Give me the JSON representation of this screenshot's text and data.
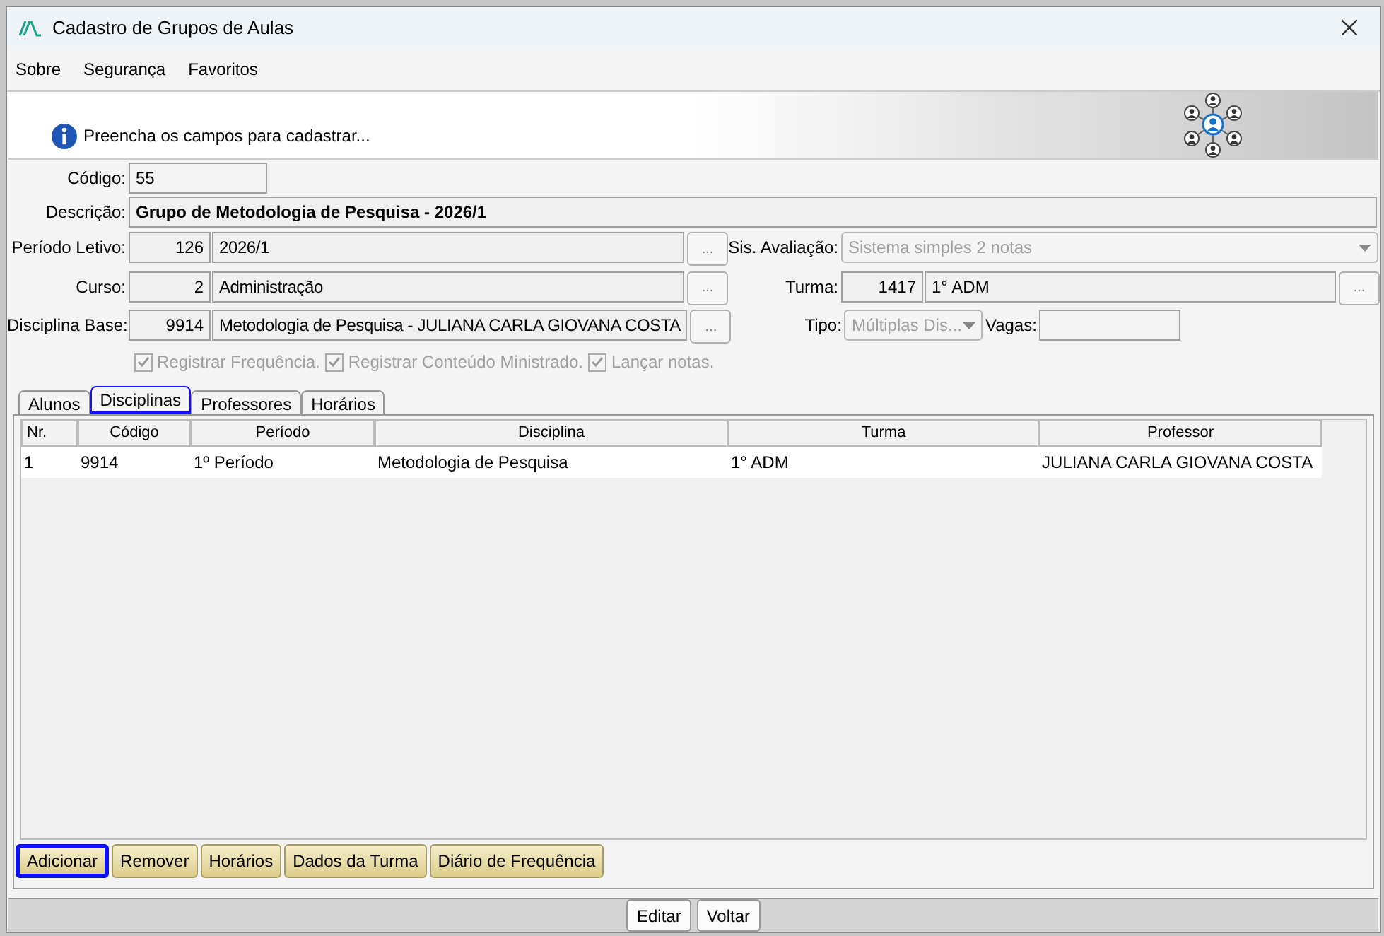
{
  "window": {
    "title": "Cadastro de Grupos de Aulas"
  },
  "menu": [
    {
      "label": "Sobre"
    },
    {
      "label": "Segurança"
    },
    {
      "label": "Favoritos"
    }
  ],
  "info": {
    "message": "Preencha os campos para cadastrar..."
  },
  "form": {
    "codigo": {
      "label": "Código:",
      "value": "55"
    },
    "descricao": {
      "label": "Descrição:",
      "value": "Grupo de Metodologia de Pesquisa - 2026/1"
    },
    "periodo": {
      "label": "Período Letivo:",
      "code": "126",
      "value": "2026/1",
      "button": "..."
    },
    "curso": {
      "label": "Curso:",
      "code": "2",
      "value": "Administração",
      "button": "..."
    },
    "disciplina": {
      "label": "Disciplina Base:",
      "code": "9914",
      "value": "Metodologia de Pesquisa - JULIANA CARLA GIOVANA COSTA",
      "button": "..."
    },
    "avaliacao": {
      "label": "Sis. Avaliação:",
      "value": "Sistema simples 2 notas",
      "disabled": true
    },
    "turma": {
      "label": "Turma:",
      "code": "1417",
      "value": "1° ADM",
      "button": "..."
    },
    "tipo": {
      "label": "Tipo:",
      "value": "Múltiplas Dis...",
      "disabled": true
    },
    "vagas": {
      "label": "Vagas:"
    },
    "checks": [
      {
        "label": "Registrar Frequência.",
        "checked": true,
        "disabled": true
      },
      {
        "label": "Registrar Conteúdo Ministrado.",
        "checked": true,
        "disabled": true
      },
      {
        "label": "Lançar notas.",
        "checked": true,
        "disabled": true
      }
    ]
  },
  "tabs": [
    {
      "label": "Alunos",
      "selected": false
    },
    {
      "label": "Disciplinas",
      "selected": true
    },
    {
      "label": "Professores",
      "selected": false
    },
    {
      "label": "Horários",
      "selected": false
    }
  ],
  "table": {
    "columns": [
      "Nr.",
      "Código",
      "Período",
      "Disciplina",
      "Turma",
      "Professor"
    ],
    "rows": [
      [
        "1",
        "9914",
        "1º Período",
        "Metodologia de Pesquisa",
        "1° ADM",
        "JULIANA CARLA GIOVANA COSTA"
      ]
    ]
  },
  "actions": [
    {
      "label": "Adicionar",
      "focused": true
    },
    {
      "label": "Remover",
      "focused": false
    },
    {
      "label": "Horários",
      "focused": false
    },
    {
      "label": "Dados da Turma",
      "focused": false
    },
    {
      "label": "Diário de Frequência",
      "focused": false
    }
  ],
  "footer": [
    "Editar",
    "Voltar"
  ]
}
